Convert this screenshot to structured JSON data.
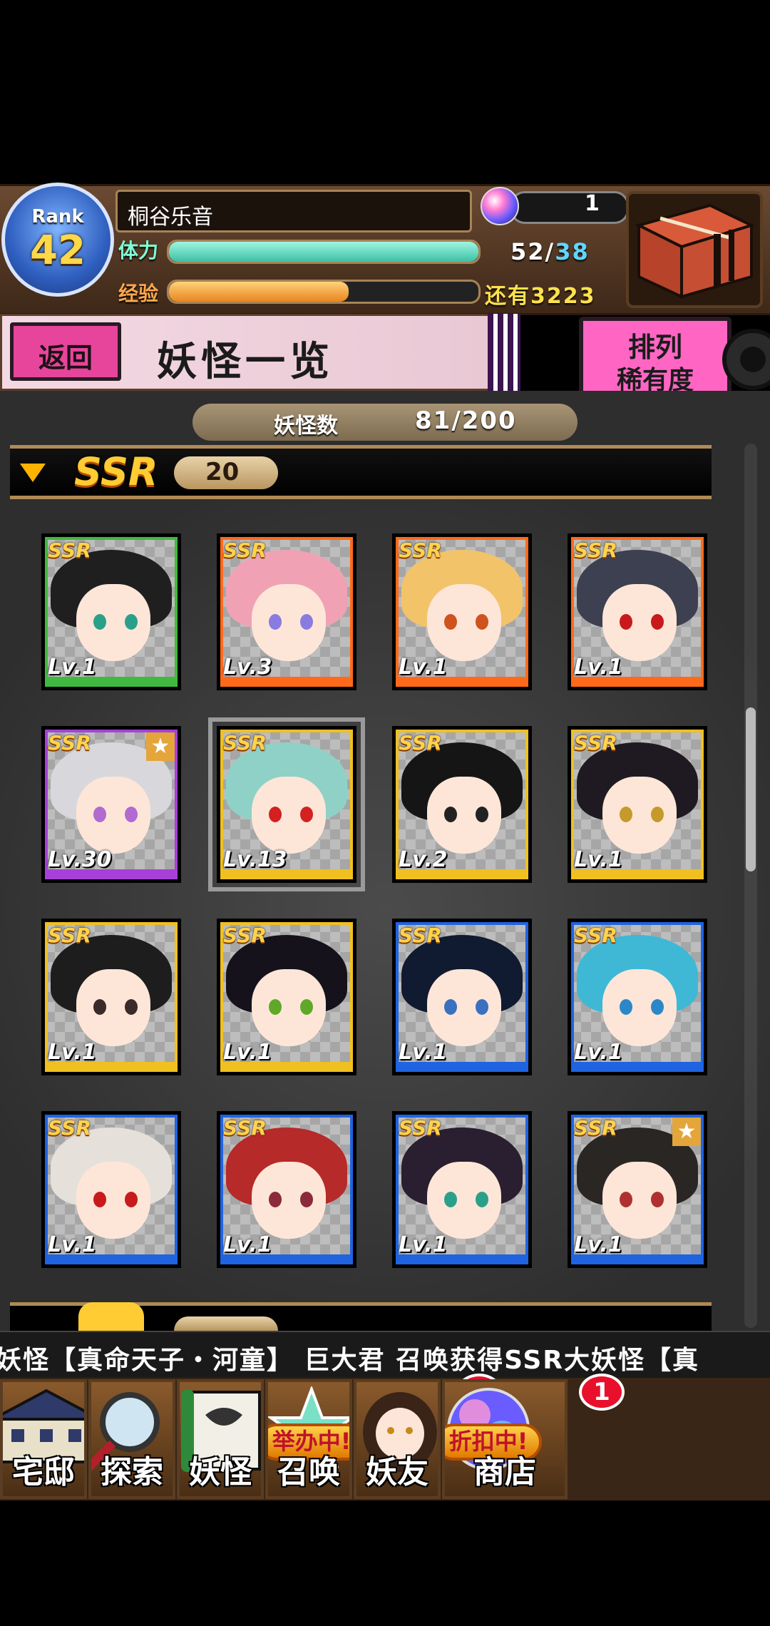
{
  "header": {
    "rank_label": "Rank",
    "rank_value": "42",
    "player_name": "桐谷乐音",
    "stamina_label": "体力",
    "stamina_current": "52",
    "stamina_sep": "/",
    "stamina_max": "38",
    "stamina_fill_fraction": 1.0,
    "exp_label": "经验",
    "exp_fill_fraction": 0.58,
    "exp_remaining": "还有3223",
    "orb_count": "1"
  },
  "title_bar": {
    "back_label": "返回",
    "title": "妖怪一览",
    "sort_label": "排列",
    "sort_value": "稀有度"
  },
  "collection": {
    "count_label": "妖怪数",
    "count_value": "81/200"
  },
  "section": {
    "rarity": "SSR",
    "count": "20"
  },
  "cards": [
    {
      "rarity": "SSR",
      "level": "Lv.1",
      "frame": "#3fb93f",
      "hair": "#1f1f1f",
      "eye": "#2aa08a",
      "star": false,
      "selected": false
    },
    {
      "rarity": "SSR",
      "level": "Lv.3",
      "frame": "#ff6a1a",
      "hair": "#f0a2b4",
      "eye": "#8a7be0",
      "star": false,
      "selected": false
    },
    {
      "rarity": "SSR",
      "level": "Lv.1",
      "frame": "#ff6a1a",
      "hair": "#f3c36a",
      "eye": "#d0521e",
      "star": false,
      "selected": false
    },
    {
      "rarity": "SSR",
      "level": "Lv.1",
      "frame": "#ff6a1a",
      "hair": "#3c4050",
      "eye": "#c81a1a",
      "star": false,
      "selected": false
    },
    {
      "rarity": "SSR",
      "level": "Lv.30",
      "frame": "#a640d8",
      "hair": "#d8d8dc",
      "eye": "#b06ad0",
      "star": true,
      "selected": false
    },
    {
      "rarity": "SSR",
      "level": "Lv.13",
      "frame": "#f0c020",
      "hair": "#8fd1c6",
      "eye": "#d42020",
      "star": false,
      "selected": true
    },
    {
      "rarity": "SSR",
      "level": "Lv.2",
      "frame": "#f0c020",
      "hair": "#151515",
      "eye": "#222222",
      "star": false,
      "selected": false
    },
    {
      "rarity": "SSR",
      "level": "Lv.1",
      "frame": "#f0c020",
      "hair": "#1f1a22",
      "eye": "#c59a2a",
      "star": false,
      "selected": false
    },
    {
      "rarity": "SSR",
      "level": "Lv.1",
      "frame": "#f0c020",
      "hair": "#1d1d1d",
      "eye": "#3a2a2a",
      "star": false,
      "selected": false
    },
    {
      "rarity": "SSR",
      "level": "Lv.1",
      "frame": "#f0c020",
      "hair": "#15121c",
      "eye": "#5fa82a",
      "star": false,
      "selected": false
    },
    {
      "rarity": "SSR",
      "level": "Lv.1",
      "frame": "#1f63e0",
      "hair": "#101a30",
      "eye": "#3a70c0",
      "star": false,
      "selected": false
    },
    {
      "rarity": "SSR",
      "level": "Lv.1",
      "frame": "#1f63e0",
      "hair": "#3fb8d6",
      "eye": "#2a88c8",
      "star": false,
      "selected": false
    },
    {
      "rarity": "SSR",
      "level": "Lv.1",
      "frame": "#1f63e0",
      "hair": "#e6e0da",
      "eye": "#c81a1a",
      "star": false,
      "selected": false
    },
    {
      "rarity": "SSR",
      "level": "Lv.1",
      "frame": "#1f63e0",
      "hair": "#b62a2a",
      "eye": "#8a2a3a",
      "star": false,
      "selected": false
    },
    {
      "rarity": "SSR",
      "level": "Lv.1",
      "frame": "#1f63e0",
      "hair": "#2a1f30",
      "eye": "#2aa08a",
      "star": false,
      "selected": false
    },
    {
      "rarity": "SSR",
      "level": "Lv.1",
      "frame": "#1f63e0",
      "hair": "#2a2624",
      "eye": "#b03030",
      "star": true,
      "selected": false
    }
  ],
  "ticker": {
    "text": "妖怪【真命天子・河童】  巨大君 召唤获得SSR大妖怪【真"
  },
  "nav": [
    {
      "label": "宅邸",
      "icon": "mansion-icon",
      "badge": "",
      "banner": ""
    },
    {
      "label": "探索",
      "icon": "magnifier-icon",
      "badge": "",
      "banner": ""
    },
    {
      "label": "妖怪",
      "icon": "scroll-icon",
      "badge": "",
      "banner": ""
    },
    {
      "label": "召唤",
      "icon": "summon-star-icon",
      "badge": "!",
      "banner": "举办中!"
    },
    {
      "label": "妖友",
      "icon": "friend-icon",
      "badge": "1",
      "banner": ""
    },
    {
      "label": "商店",
      "icon": "shop-orb-icon",
      "badge": "",
      "banner": "折扣中!"
    }
  ],
  "colors": {
    "accent_pink": "#e6459b",
    "gold": "#ffcc33",
    "stamina": "#3cc0a4",
    "exp": "#e8841e"
  }
}
